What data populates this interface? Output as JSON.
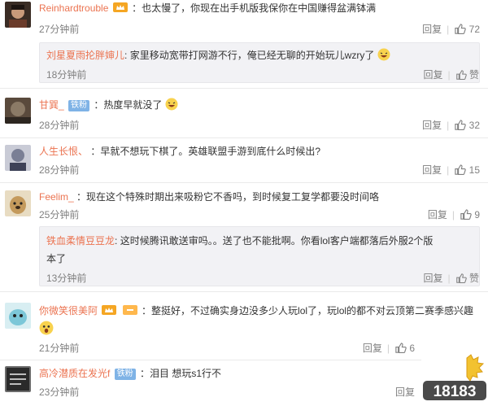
{
  "ui": {
    "reply_label": "回复",
    "bullet": "•",
    "colon": ":"
  },
  "comments": [
    {
      "user": "Reinhardtrouble",
      "text": "：也太慢了，你现在出手机版我保你在中国赚得盆满钵满",
      "time": "27分钟前",
      "likes": "72",
      "reply": {
        "user": "刘星夏雨抡胖婶儿",
        "text": "家里移动宽带打网游不行，俺已经无聊的开始玩儿wzry了",
        "time": "18分钟前",
        "like_label": "赞"
      }
    },
    {
      "user": "甘巽_",
      "badge": "铁粉",
      "text": "：热度早就没了",
      "time": "28分钟前",
      "likes": "32"
    },
    {
      "user": "人生长恨、",
      "text": "：早就不想玩下棋了。英雄联盟手游到底什么时候出?",
      "time": "28分钟前",
      "likes": "15"
    },
    {
      "user": "Feelim_",
      "text": "：现在这个特殊时期出来吸粉它不香吗，到时候复工复学都要没时间咯",
      "time": "25分钟前",
      "likes": "9",
      "reply": {
        "user": "铁血柔情豆豆龙",
        "text": "这时候腾讯敢送审吗。。送了也不能批啊。你看lol客户端都落后外服2个版",
        "text2": "本了",
        "time": "13分钟前",
        "like_label": "赞"
      }
    },
    {
      "user": "你微笑很美阿",
      "text": "：整挺好，不过确实身边没多少人玩lol了，玩lol的都不对云顶第二赛季感兴趣",
      "time": "21分钟前",
      "likes": "6"
    },
    {
      "user": "高冷潜质在发光f",
      "badge": "铁粉",
      "text": "：泪目 想玩s1行不",
      "time": "23分钟前"
    }
  ],
  "watermark": {
    "logo_text": "18183"
  },
  "colors": {
    "username": "#eb7350",
    "meta": "#808080",
    "badge": "#7fb3e6",
    "reply_bg": "#f2f2f5"
  }
}
